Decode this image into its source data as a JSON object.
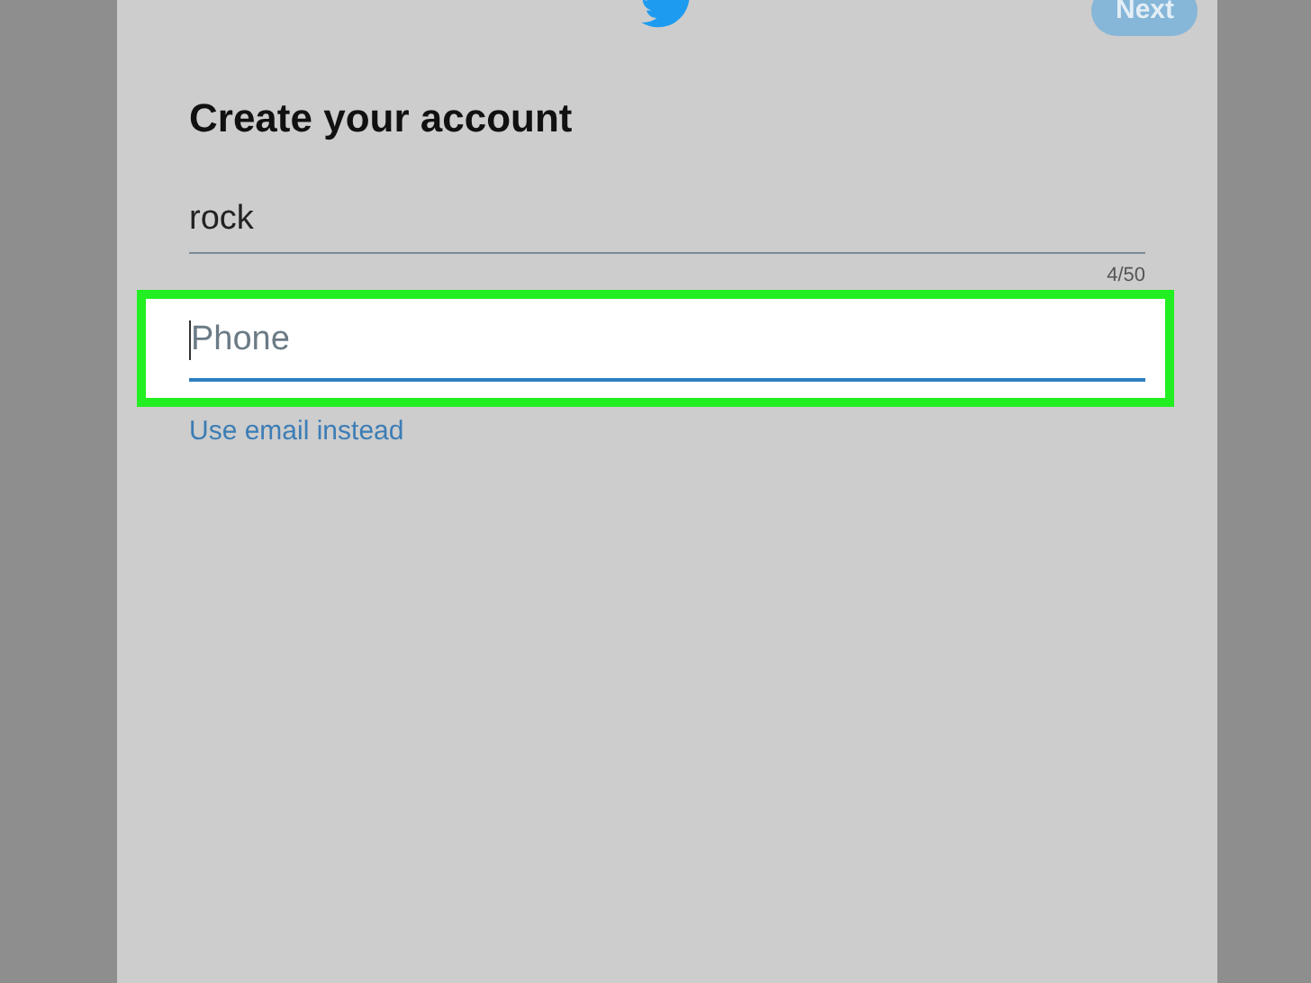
{
  "header": {
    "next_button": {
      "label": "Next",
      "disabled": true
    }
  },
  "title": "Create your account",
  "name_field": {
    "value": "rock",
    "counter": "4/50"
  },
  "phone_field": {
    "placeholder": "Phone",
    "focused": true,
    "highlighted": true
  },
  "switch_link": "Use email instead"
}
